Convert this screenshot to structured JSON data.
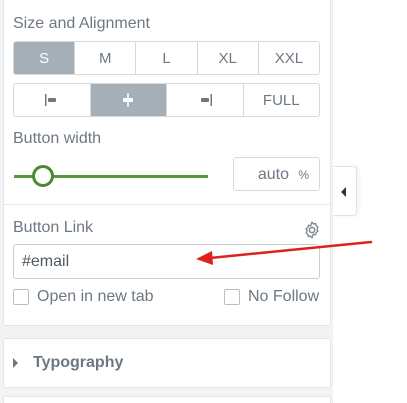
{
  "size_alignment": {
    "title": "Size and Alignment",
    "sizes": [
      "S",
      "M",
      "L",
      "XL",
      "XXL"
    ],
    "active_size": "S",
    "alignment_full_label": "FULL",
    "active_alignment": "center"
  },
  "button_width": {
    "title": "Button width",
    "value": "auto",
    "unit": "%",
    "slider_level_fraction": 0.15
  },
  "button_link": {
    "title": "Button Link",
    "value": "#email",
    "open_new_tab_label": "Open in new tab",
    "open_new_tab_checked": false,
    "no_follow_label": "No Follow",
    "no_follow_checked": false
  },
  "typography": {
    "label": "Typography"
  },
  "colors": {
    "accent_green": "#5b9a3b",
    "active_segment": "#a4afb7",
    "annotation_red": "#e0201b"
  },
  "icons": {
    "settings": "gear-icon",
    "collapse": "caret-left-icon",
    "expand": "caret-right-icon"
  }
}
